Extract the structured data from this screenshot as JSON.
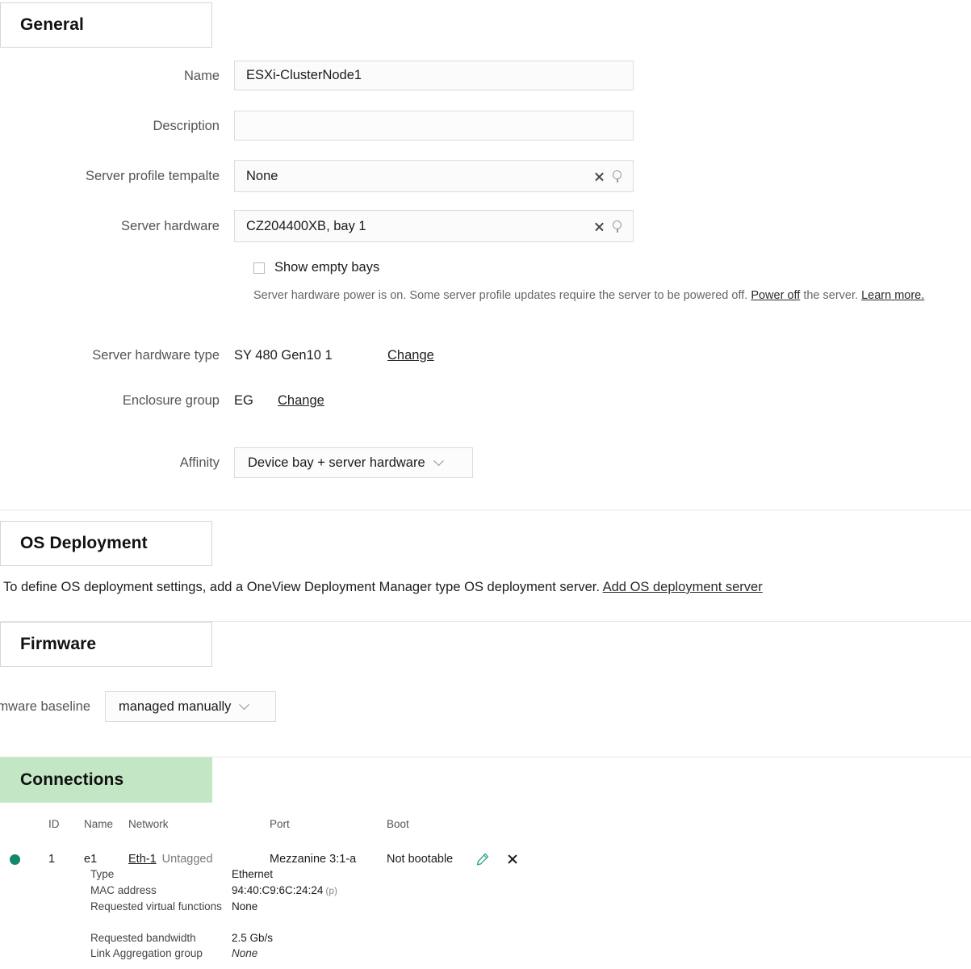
{
  "sections": {
    "general": {
      "title": "General"
    },
    "os_deployment": {
      "title": "OS Deployment",
      "message": "To define OS deployment settings, add a OneView Deployment Manager type OS deployment server. ",
      "add_link": "Add OS deployment server"
    },
    "firmware": {
      "title": "Firmware"
    },
    "connections": {
      "title": "Connections"
    }
  },
  "general": {
    "name": {
      "label": "Name",
      "value": "ESXi-ClusterNode1"
    },
    "description": {
      "label": "Description",
      "value": ""
    },
    "server_profile_template": {
      "label": "Server profile tempalte",
      "value": "None",
      "clear_icon": "clear-icon",
      "search_icon": "search-icon"
    },
    "server_hardware": {
      "label": "Server hardware",
      "value": "CZ204400XB, bay 1",
      "clear_icon": "clear-icon",
      "search_icon": "search-icon"
    },
    "show_empty_bays": {
      "label": "Show empty bays",
      "checked": false
    },
    "power_message": {
      "part1": "Server hardware power is on. Some server profile updates require the server to be powered off. ",
      "power_off_link": "Power off",
      "part2": " the server. ",
      "learn_more_link": "Learn more."
    },
    "server_hardware_type": {
      "label": "Server hardware type",
      "value": "SY 480 Gen10 1",
      "change_link": "Change"
    },
    "enclosure_group": {
      "label": "Enclosure group",
      "value": "EG",
      "change_link": "Change"
    },
    "affinity": {
      "label": "Affinity",
      "value": "Device bay + server hardware"
    }
  },
  "firmware": {
    "baseline": {
      "label": "Firmware baseline",
      "value": "managed manually"
    }
  },
  "connections": {
    "headers": {
      "id": "ID",
      "name": "Name",
      "network": "Network",
      "port": "Port",
      "boot": "Boot"
    },
    "rows": [
      {
        "status": "ok",
        "id": "1",
        "name": "e1",
        "network_link": "Eth-1",
        "network_tag": "Untagged",
        "port": "Mezzanine 3:1-a",
        "boot": "Not bootable",
        "edit_icon": "pencil-icon",
        "delete_icon": "close-icon",
        "details": [
          {
            "key": "Type",
            "value": "Ethernet",
            "suffix": "",
            "italic": false
          },
          {
            "key": "MAC address",
            "value": "94:40:C9:6C:24:24",
            "suffix": "(p)",
            "italic": false
          },
          {
            "key": "Requested virtual functions",
            "value": "None",
            "suffix": "",
            "italic": false
          },
          {
            "key": "Requested bandwidth",
            "value": "2.5 Gb/s",
            "suffix": "",
            "italic": false
          },
          {
            "key": "Link Aggregation group",
            "value": "None",
            "suffix": "",
            "italic": true
          }
        ]
      }
    ]
  },
  "colors": {
    "connections_header_bg": "#c3e6c4",
    "status_ok": "#14866a",
    "edit_icon": "#2aa888"
  }
}
